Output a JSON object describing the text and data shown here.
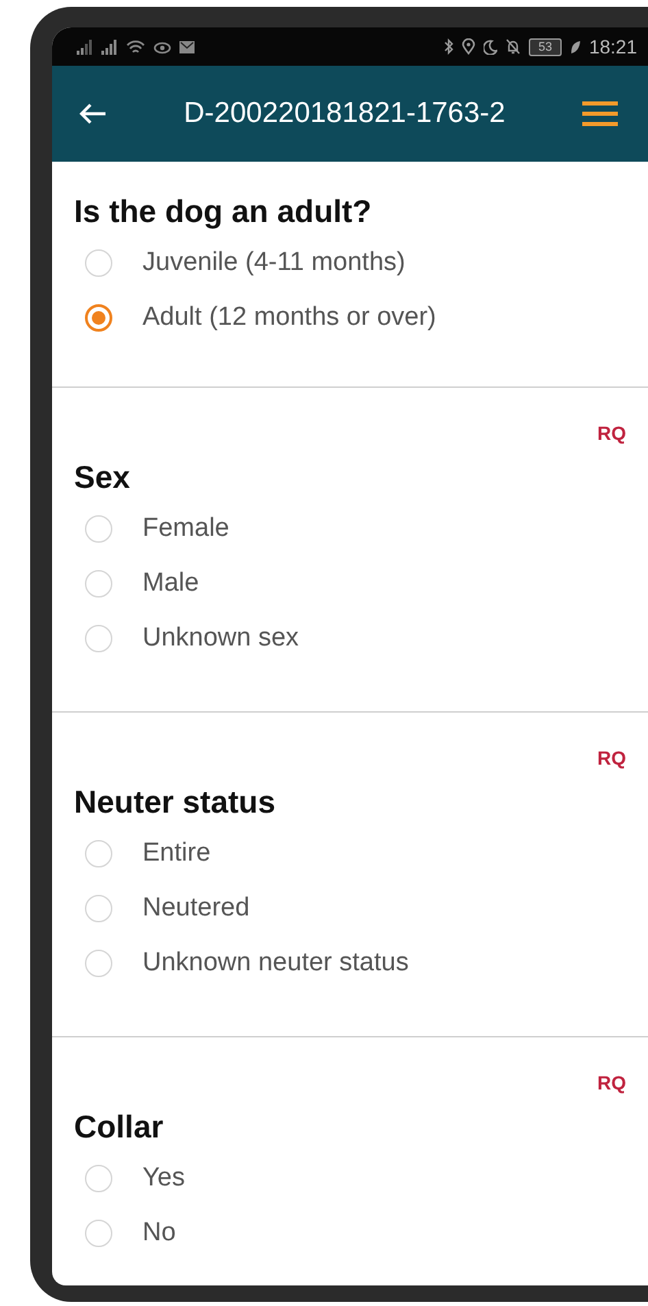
{
  "status_bar": {
    "battery": "53",
    "time": "18:21"
  },
  "header": {
    "title": "D-200220181821-1763-2"
  },
  "questions": [
    {
      "title": "Is the dog an adult?",
      "options": [
        {
          "label": "Juvenile (4-11 months)",
          "selected": false
        },
        {
          "label": "Adult (12 months or over)",
          "selected": true
        }
      ]
    },
    {
      "title": "Sex",
      "required_label": "RQ",
      "options": [
        {
          "label": "Female",
          "selected": false
        },
        {
          "label": "Male",
          "selected": false
        },
        {
          "label": "Unknown sex",
          "selected": false
        }
      ]
    },
    {
      "title": "Neuter status",
      "required_label": "RQ",
      "options": [
        {
          "label": "Entire",
          "selected": false
        },
        {
          "label": "Neutered",
          "selected": false
        },
        {
          "label": "Unknown neuter status",
          "selected": false
        }
      ]
    },
    {
      "title": "Collar",
      "required_label": "RQ",
      "options": [
        {
          "label": "Yes",
          "selected": false
        },
        {
          "label": "No",
          "selected": false
        }
      ]
    }
  ]
}
